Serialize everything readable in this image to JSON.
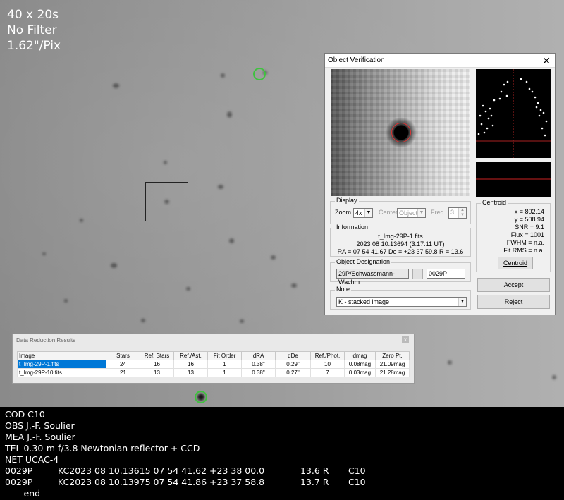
{
  "overlay": {
    "lines": [
      "40 x 20s",
      "No Filter",
      "1.62\"/Pix"
    ]
  },
  "object_verification": {
    "title": "Object Verification",
    "display": {
      "legend": "Display",
      "zoom_label": "Zoom",
      "zoom_value": "4x",
      "center_label": "Center",
      "center_value": "Object",
      "freq_label": "Freq.",
      "freq_value": "3"
    },
    "information": {
      "legend": "Information",
      "file": "t_Img-29P-1.fits",
      "datetime": "2023 08 10.13694 (3:17:11 UT)",
      "coords": "RA = 07 54 41.67   De = +23 37 59.8   R = 13.6"
    },
    "designation": {
      "legend": "Object Designation",
      "name": "29P/Schwassmann-Wachm",
      "code": "0029P"
    },
    "note": {
      "legend": "Note",
      "value": "K - stacked image"
    },
    "centroid": {
      "legend": "Centroid",
      "lines": [
        "x = 802.14",
        "y = 508.94",
        "SNR = 9.1",
        "Flux = 1001",
        "FWHM = n.a.",
        "Fit RMS = n.a."
      ],
      "button": "Centroid"
    },
    "accept_label": "Accept",
    "reject_label": "Reject"
  },
  "data_reduction": {
    "title": "Data Reduction Results",
    "close": "x",
    "columns": [
      "Image",
      "Stars",
      "Ref. Stars",
      "Ref./Ast.",
      "Fit Order",
      "dRA",
      "dDe",
      "Ref./Phot.",
      "dmag",
      "Zero Pt."
    ],
    "rows": [
      [
        "t_Img-29P-1.fits",
        "24",
        "16",
        "16",
        "1",
        "0.38\"",
        "0.29\"",
        "10",
        "0.08mag",
        "21.09mag"
      ],
      [
        "t_Img-29P-10.fits",
        "21",
        "13",
        "13",
        "1",
        "0.38\"",
        "0.27\"",
        "7",
        "0.03mag",
        "21.28mag"
      ]
    ]
  },
  "report": {
    "header_lines": [
      "COD C10",
      "OBS J.-F. Soulier",
      "MEA J.-F. Soulier",
      "TEL 0.30-m f/3.8 Newtonian reflector + CCD",
      "NET UCAC-4"
    ],
    "observations": [
      {
        "id": "0029P",
        "data": "KC2023 08 10.13615 07 54 41.62 +23 38 00.0",
        "mag": "13.6 R",
        "code": "C10"
      },
      {
        "id": "0029P",
        "data": "KC2023 08 10.13975 07 54 41.86 +23 37 58.8",
        "mag": "13.7 R",
        "code": "C10"
      }
    ],
    "end_line": "----- end -----"
  }
}
